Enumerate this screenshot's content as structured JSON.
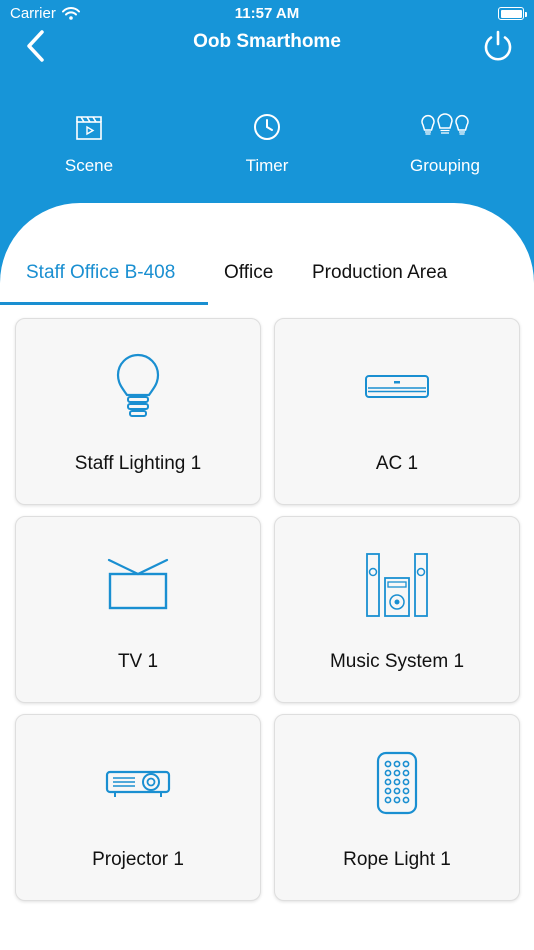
{
  "status_bar": {
    "carrier": "Carrier",
    "time": "11:57 AM"
  },
  "header": {
    "title": "Oob Smarthome"
  },
  "actions": [
    {
      "label": "Scene",
      "icon": "clapperboard-icon"
    },
    {
      "label": "Timer",
      "icon": "clock-icon"
    },
    {
      "label": "Grouping",
      "icon": "bulbs-group-icon"
    }
  ],
  "tabs": [
    {
      "label": "Staff Office B-408",
      "active": true
    },
    {
      "label": "Office",
      "active": false
    },
    {
      "label": "Production Area",
      "active": false
    }
  ],
  "devices": [
    {
      "name": "Staff Lighting 1",
      "icon": "light-bulb-icon"
    },
    {
      "name": "AC 1",
      "icon": "air-conditioner-icon"
    },
    {
      "name": "TV 1",
      "icon": "tv-icon"
    },
    {
      "name": "Music System 1",
      "icon": "speaker-system-icon"
    },
    {
      "name": "Projector 1",
      "icon": "projector-icon"
    },
    {
      "name": "Rope Light 1",
      "icon": "remote-control-icon"
    }
  ],
  "colors": {
    "accent": "#1795d8",
    "icon_blue": "#1a8fd1",
    "card_bg": "#f7f7f7"
  }
}
